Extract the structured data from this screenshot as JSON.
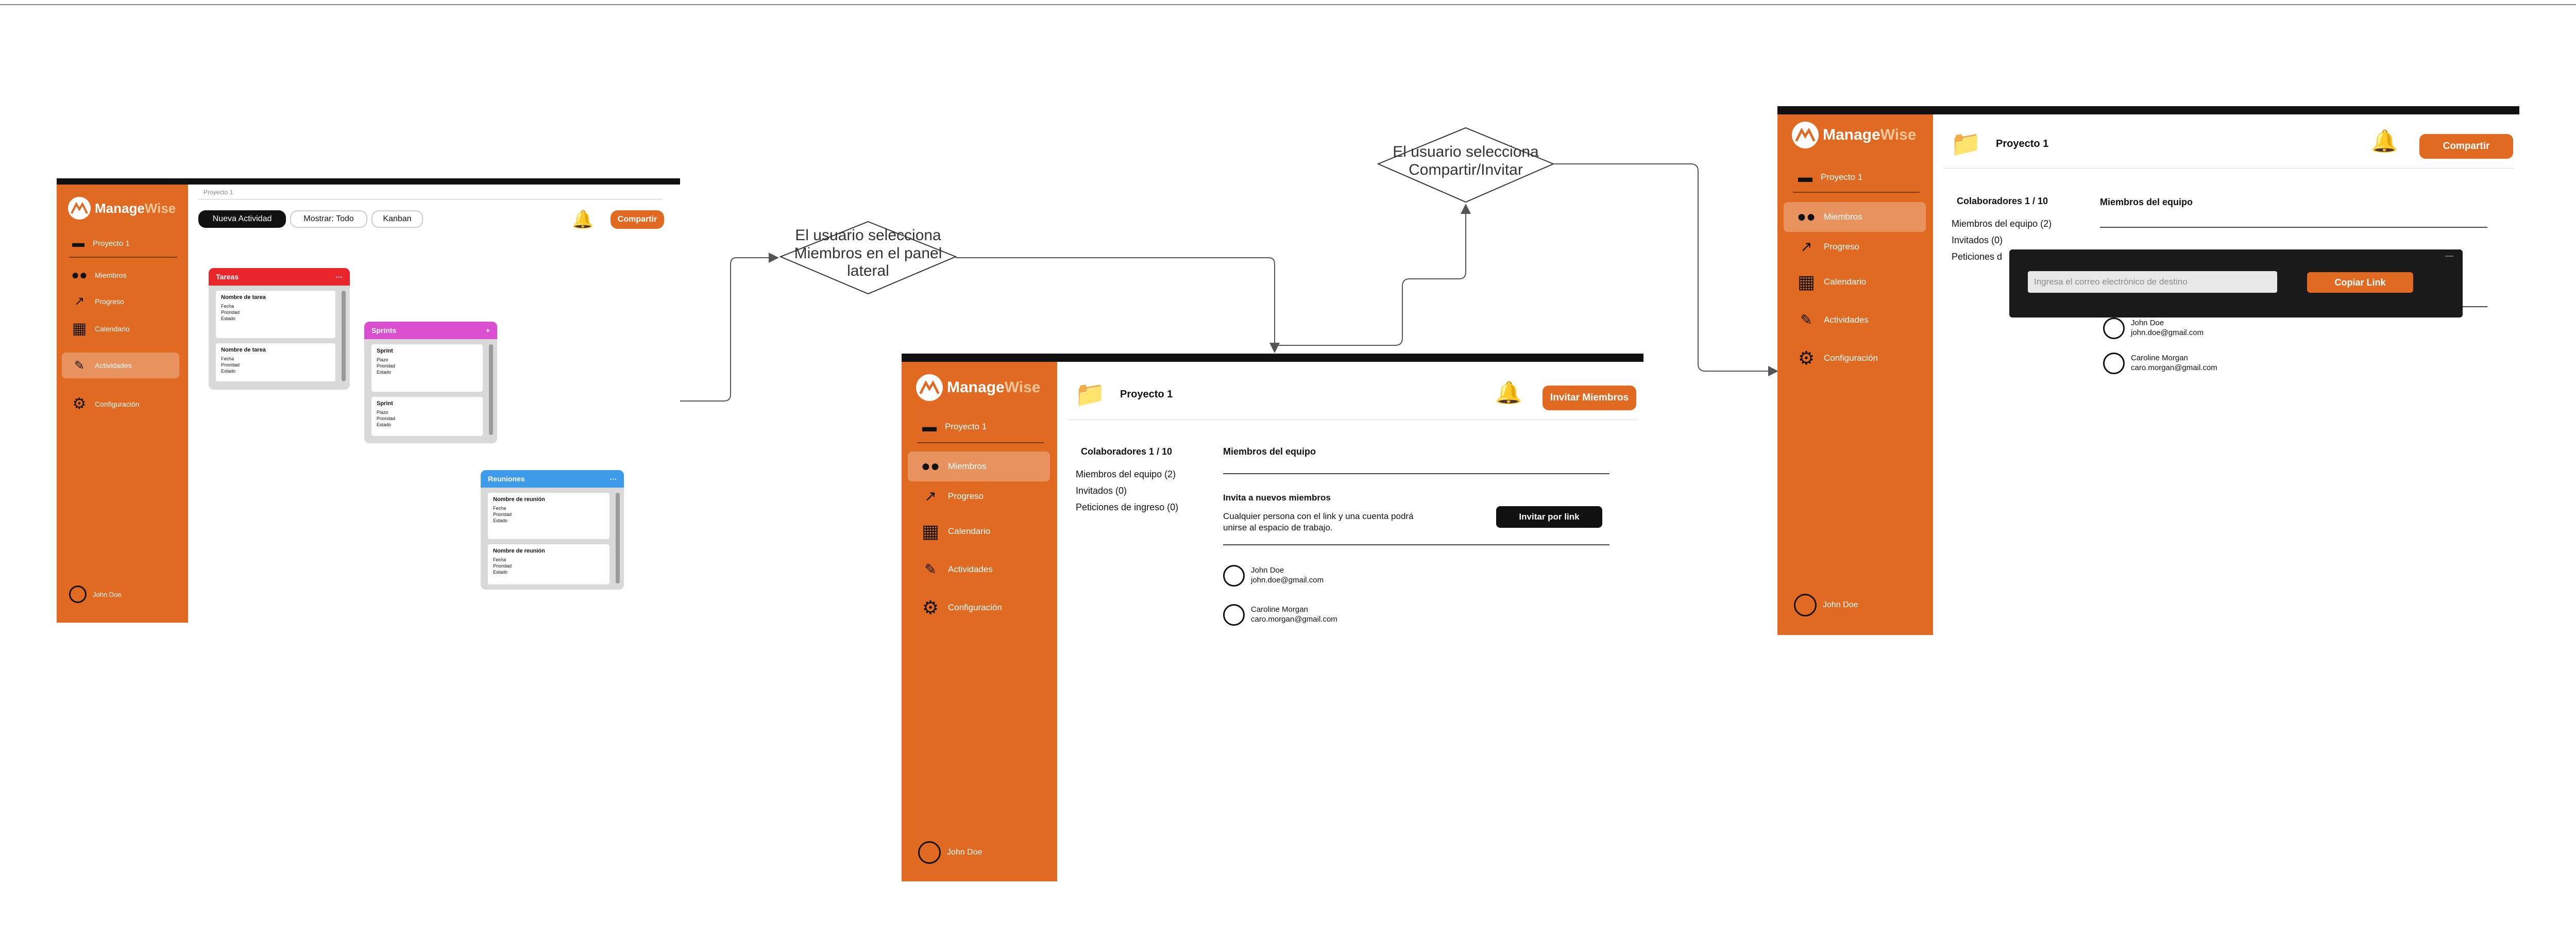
{
  "flow": {
    "decision_members": "El usuario selecciona Miembros en el panel lateral",
    "decision_share": "El usuario selecciona Compartir/Invitar"
  },
  "app": {
    "brand_main": "Manage",
    "brand_accent": "Wise",
    "project": "Proyecto 1",
    "user_name": "John Doe",
    "nav": {
      "members": "Miembros",
      "progress": "Progreso",
      "calendar": "Calendario",
      "activities": "Actividades",
      "settings": "Configuración"
    },
    "colors": {
      "sidebar": "#e06a22",
      "accent": "#e06a22",
      "dark": "#111111"
    }
  },
  "kanban_screen": {
    "breadcrumb": "Proyecto 1",
    "new_activity": "Nueva Actividad",
    "show_filter": "Mostrar: Todo",
    "view": "Kanban",
    "share": "Compartir",
    "columns": [
      {
        "title": "Tareas",
        "color": "#e8262c",
        "cards": [
          {
            "title": "Nombre de tarea",
            "lines": [
              "Fecha",
              "Prioridad",
              "Estado"
            ]
          },
          {
            "title": "Nombre de tarea",
            "lines": [
              "Fecha",
              "Prioridad",
              "Estado"
            ]
          }
        ]
      },
      {
        "title": "Sprints",
        "color": "#d94fd0",
        "cards": [
          {
            "title": "Sprint",
            "lines": [
              "Plazo",
              "Prioridad",
              "Estado"
            ]
          },
          {
            "title": "Sprint",
            "lines": [
              "Plazo",
              "Prioridad",
              "Estado"
            ]
          }
        ]
      },
      {
        "title": "Reuniones",
        "color": "#3d9be9",
        "cards": [
          {
            "title": "Nombre de reunión",
            "lines": [
              "Fecha",
              "Prioridad",
              "Estado"
            ]
          },
          {
            "title": "Nombre de reunión",
            "lines": [
              "Fecha",
              "Prioridad",
              "Estado"
            ]
          }
        ]
      }
    ]
  },
  "members_screen": {
    "invite_members": "Invitar Miembros",
    "collaborators": "Colaboradores 1 / 10",
    "team_members": "Miembros del equipo (2)",
    "guests": "Invitados (0)",
    "join_requests": "Peticiones de ingreso (0)",
    "team_heading": "Miembros del equipo",
    "invite_heading": "Invita a nuevos miembros",
    "invite_desc_1": "Cualquier persona con el link y una cuenta podrá",
    "invite_desc_2": "unirse al espacio de trabajo.",
    "invite_link": "Invitar por link",
    "members": [
      {
        "name": "John Doe",
        "email": "john.doe@gmail.com"
      },
      {
        "name": "Caroline Morgan",
        "email": "caro.morgan@gmail.com"
      }
    ]
  },
  "share_screen": {
    "share": "Compartir",
    "collaborators": "Colaboradores 1 / 10",
    "team_members": "Miembros del equipo (2)",
    "guests": "Invitados (0)",
    "join_requests_partial": "Peticiones d",
    "team_heading": "Miembros del equipo",
    "email_placeholder": "Ingresa el correo electrónico de destino",
    "copy_link": "Copiar Link",
    "modal_close": "—",
    "members": [
      {
        "name": "John Doe",
        "email": "john.doe@gmail.com"
      },
      {
        "name": "Caroline Morgan",
        "email": "caro.morgan@gmail.com"
      }
    ]
  }
}
